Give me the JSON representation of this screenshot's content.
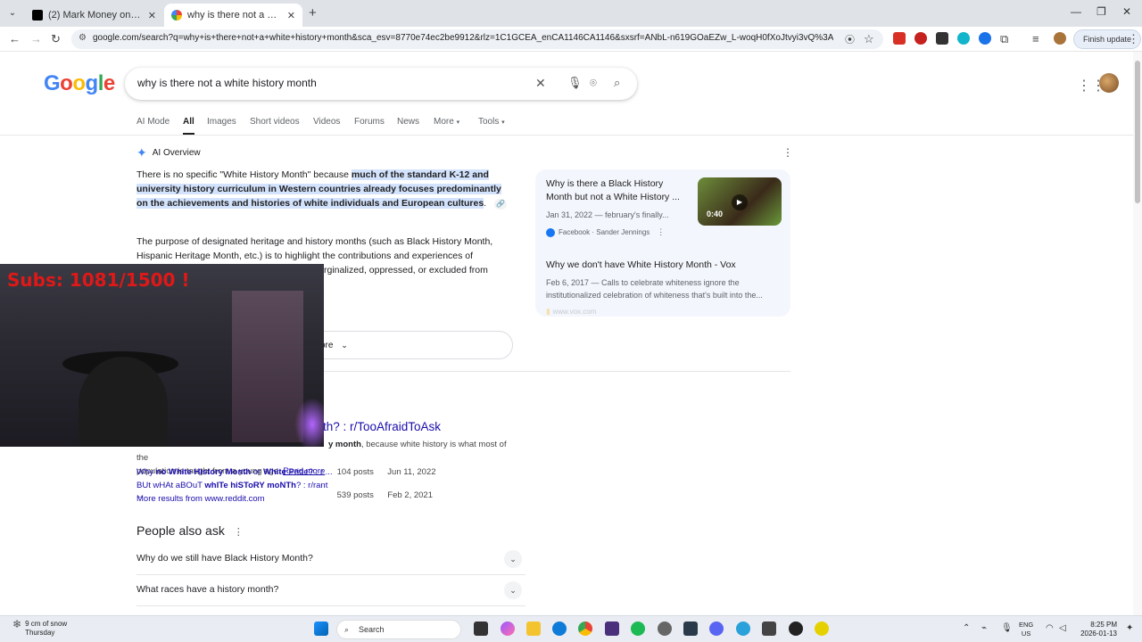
{
  "browser": {
    "tabs": [
      {
        "title": "(2) Mark Money on X: \"Rare fo",
        "active": false
      },
      {
        "title": "why is there not a white histor",
        "active": true
      }
    ],
    "url": "google.com/search?q=why+is+there+not+a+white+history+month&sca_esv=8770e74ec2be9912&rlz=1C1GCEA_enCA1146CA1146&sxsrf=ANbL-n619GOaEZw_L-woqH0fXoJtvyi3vQ%3A176835379125...",
    "finish_update": "Finish update"
  },
  "google": {
    "logo": "Google",
    "query": "why is there not a white history month",
    "tabs": [
      "AI Mode",
      "All",
      "Images",
      "Short videos",
      "Videos",
      "Forums",
      "News",
      "More",
      "Tools"
    ],
    "active_tab": "All"
  },
  "ai_overview": {
    "label": "AI Overview",
    "p1_pre": "There is no specific \"White History Month\" because ",
    "p1_highlight": "much of the standard K-12 and university history curriculum in Western countries already focuses predominantly on the achievements and histories of white individuals and European cultures",
    "p1_post": ".",
    "p2": "The purpose of designated heritage and history months (such as Black History Month, Hispanic Heritage Month, etc.) is to highlight the contributions and experiences of",
    "p2_cont": "rginalized, oppressed, or excluded from",
    "show_more": "ore"
  },
  "side_results": [
    {
      "title": "Why is there a Black History Month but not a White History ...",
      "meta": "Jan 31, 2022 — february's finally...",
      "source": "Facebook · Sander Jennings",
      "duration": "0:40"
    },
    {
      "title": "Why we don't have White History Month - Vox",
      "meta": "Feb 6, 2017 — Calls to celebrate whiteness ignore the institutionalized celebration of whiteness that's built into the...",
      "source": "www.vox.com"
    }
  ],
  "reddit_result": {
    "title": "th? : r/TooAfraidToAsk",
    "snippet_bold": "y month",
    "snippet_rest": ", because white history is what most of the",
    "snippet_line2": "population is taught from a young age.",
    "read_more": "Read more",
    "sub_results": [
      {
        "pre": "Why ",
        "b1": "no White History Month",
        "mid": " or ",
        "b2": "White",
        "post": " Pride? : r ...",
        "posts": "104 posts",
        "date": "Jun 11, 2022"
      },
      {
        "pre": "BUt wHAt aBOuT ",
        "b1": "whITe hiSToRY moNTh",
        "mid": "",
        "b2": "",
        "post": "? : r/rant ...",
        "posts": "539 posts",
        "date": "Feb 2, 2021"
      }
    ],
    "more_results": "More results from www.reddit.com"
  },
  "people_also_ask": {
    "heading": "People also ask",
    "questions": [
      "Why do we still have Black History Month?",
      "What races have a history month?"
    ]
  },
  "webcam": {
    "overlay_text": "Subs: 1081/1500 !"
  },
  "taskbar": {
    "weather_line1": "9 cm of snow",
    "weather_line2": "Thursday",
    "search_label": "Search",
    "lang_line1": "ENG",
    "lang_line2": "US",
    "time": "8:25 PM",
    "date": "2026-01-13"
  }
}
